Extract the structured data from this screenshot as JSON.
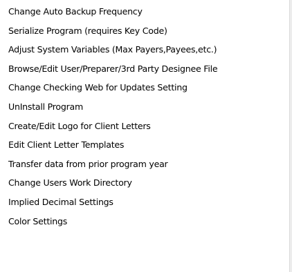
{
  "menu": {
    "items": [
      {
        "label": "Change Auto Backup Frequency"
      },
      {
        "label": "Serialize Program (requires Key Code)"
      },
      {
        "label": "Adjust System Variables (Max Payers,Payees,etc.)"
      },
      {
        "label": "Browse/Edit User/Preparer/3rd Party Designee File"
      },
      {
        "label": "Change Checking Web for Updates Setting"
      },
      {
        "label": "UnInstall Program"
      },
      {
        "label": "Create/Edit Logo for Client Letters"
      },
      {
        "label": "Edit Client Letter Templates"
      },
      {
        "label": "Transfer data from prior program year"
      },
      {
        "label": "Change Users Work Directory"
      },
      {
        "label": "Implied Decimal Settings"
      },
      {
        "label": "Color Settings"
      }
    ]
  },
  "colors": {
    "background": "#ffffff",
    "text": "#000000",
    "hover": "#cce8ff"
  }
}
